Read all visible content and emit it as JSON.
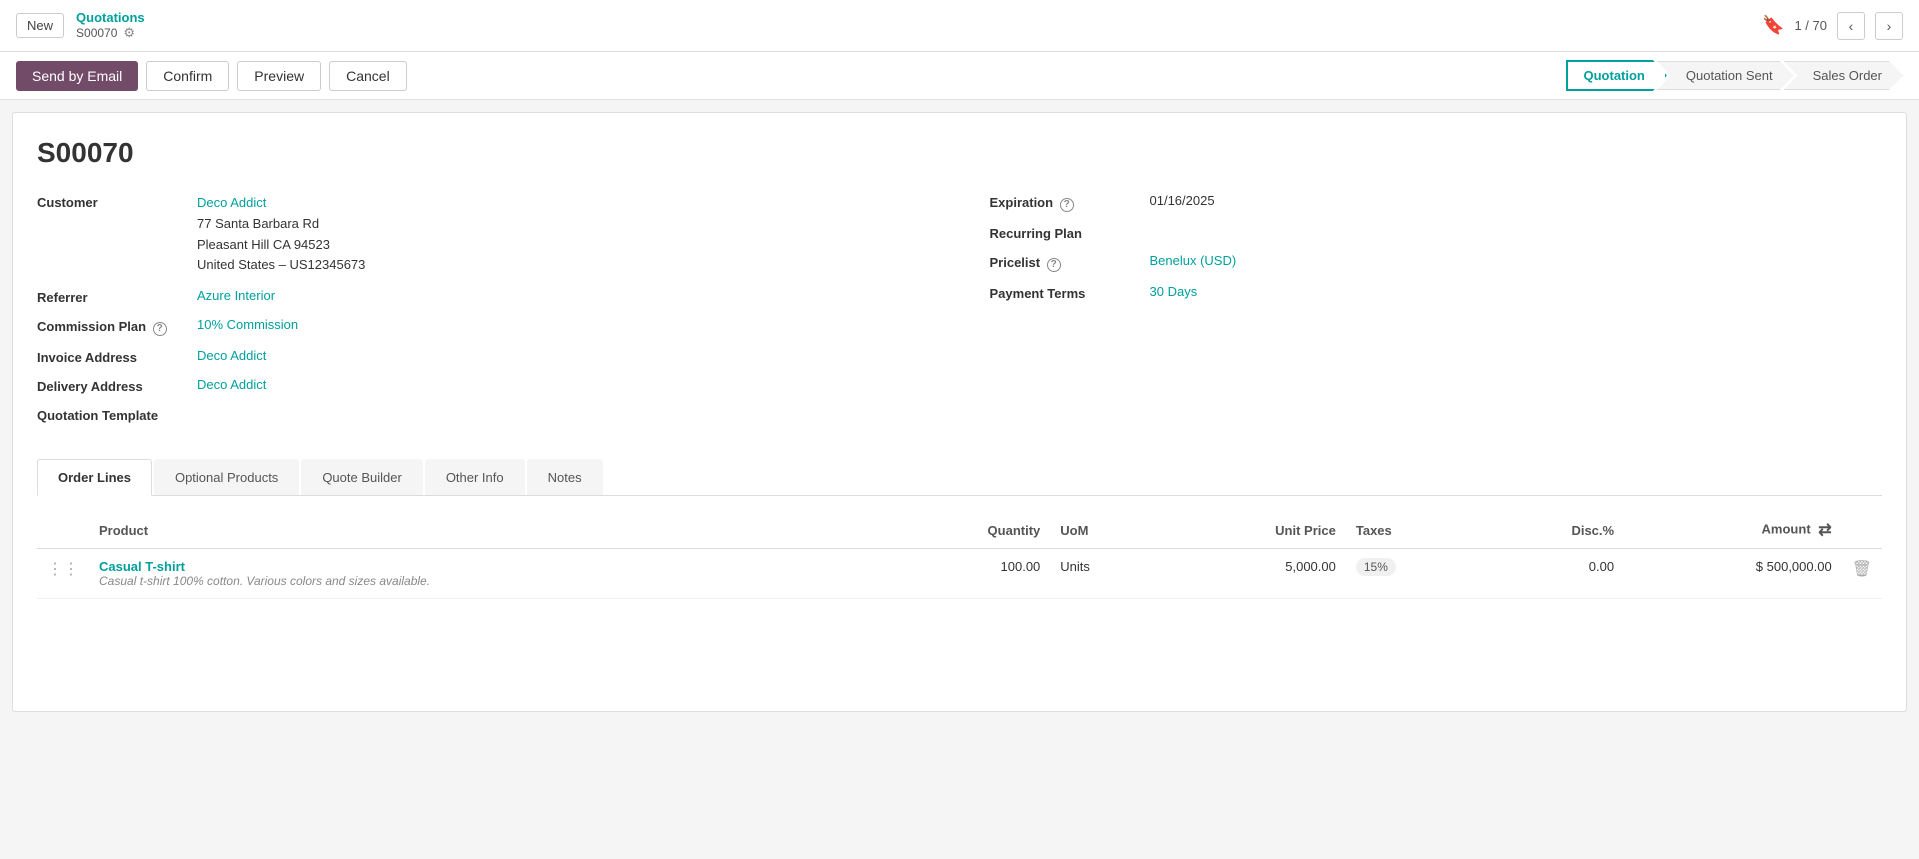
{
  "topbar": {
    "new_label": "New",
    "breadcrumb_title": "Quotations",
    "breadcrumb_sub": "S00070",
    "page_info": "1 / 70"
  },
  "actions": {
    "send_email": "Send by Email",
    "confirm": "Confirm",
    "preview": "Preview",
    "cancel": "Cancel"
  },
  "pipeline": {
    "steps": [
      {
        "id": "quotation",
        "label": "Quotation",
        "active": true
      },
      {
        "id": "quotation_sent",
        "label": "Quotation Sent",
        "active": false
      },
      {
        "id": "sales_order",
        "label": "Sales Order",
        "active": false
      }
    ]
  },
  "record": {
    "title": "S00070",
    "customer_label": "Customer",
    "customer_name": "Deco Addict",
    "customer_address1": "77 Santa Barbara Rd",
    "customer_address2": "Pleasant Hill CA 94523",
    "customer_address3": "United States – US12345673",
    "referrer_label": "Referrer",
    "referrer_value": "Azure Interior",
    "commission_plan_label": "Commission Plan",
    "commission_plan_help": "?",
    "commission_plan_value": "10% Commission",
    "invoice_address_label": "Invoice Address",
    "invoice_address_value": "Deco Addict",
    "delivery_address_label": "Delivery Address",
    "delivery_address_value": "Deco Addict",
    "quotation_template_label": "Quotation Template",
    "quotation_template_value": "",
    "expiration_label": "Expiration",
    "expiration_help": "?",
    "expiration_value": "01/16/2025",
    "recurring_plan_label": "Recurring Plan",
    "recurring_plan_value": "",
    "pricelist_label": "Pricelist",
    "pricelist_help": "?",
    "pricelist_value": "Benelux (USD)",
    "payment_terms_label": "Payment Terms",
    "payment_terms_value": "30 Days"
  },
  "tabs": [
    {
      "id": "order_lines",
      "label": "Order Lines",
      "active": true
    },
    {
      "id": "optional_products",
      "label": "Optional Products",
      "active": false
    },
    {
      "id": "quote_builder",
      "label": "Quote Builder",
      "active": false
    },
    {
      "id": "other_info",
      "label": "Other Info",
      "active": false
    },
    {
      "id": "notes",
      "label": "Notes",
      "active": false
    }
  ],
  "table": {
    "columns": [
      {
        "id": "product",
        "label": "Product"
      },
      {
        "id": "quantity",
        "label": "Quantity"
      },
      {
        "id": "uom",
        "label": "UoM"
      },
      {
        "id": "unit_price",
        "label": "Unit Price"
      },
      {
        "id": "taxes",
        "label": "Taxes"
      },
      {
        "id": "disc",
        "label": "Disc.%"
      },
      {
        "id": "amount",
        "label": "Amount"
      }
    ],
    "rows": [
      {
        "product_name": "Casual T-shirt",
        "product_desc": "Casual t-shirt 100% cotton. Various colors and sizes available.",
        "quantity": "100.00",
        "uom": "Units",
        "unit_price": "5,000.00",
        "taxes": "15%",
        "disc": "0.00",
        "amount": "$ 500,000.00"
      }
    ]
  }
}
